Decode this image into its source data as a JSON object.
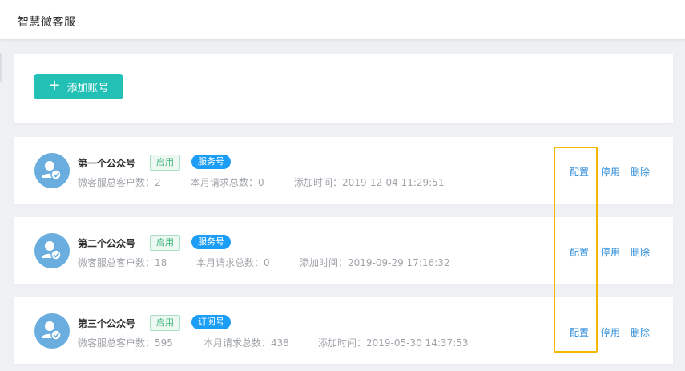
{
  "app": {
    "title": "智慧微客服"
  },
  "toolbar": {
    "add_label": "添加账号",
    "add_icon": "plus-icon"
  },
  "accounts": [
    {
      "name": "第一个公众号",
      "status": "启用",
      "type": "服务号",
      "customers": "微客服总客户数：2",
      "requests": "本月请求总数：0",
      "added": "添加时间：2019-12-04 11:29:51",
      "actions": {
        "config": "配置",
        "disable": "停用",
        "delete": "删除"
      }
    },
    {
      "name": "第二个公众号",
      "status": "启用",
      "type": "服务号",
      "customers": "微客服总客户数：18",
      "requests": "本月请求总数：0",
      "added": "添加时间：2019-09-29 17:16:32",
      "actions": {
        "config": "配置",
        "disable": "停用",
        "delete": "删除"
      }
    },
    {
      "name": "第三个公众号",
      "status": "启用",
      "type": "订阅号",
      "customers": "微客服总客户数：595",
      "requests": "本月请求总数：438",
      "added": "添加时间：2019-05-30 14:37:53",
      "actions": {
        "config": "配置",
        "disable": "停用",
        "delete": "删除"
      }
    }
  ],
  "colors": {
    "primary": "#22c0b5",
    "link": "#2a8ad8",
    "tag_blue": "#1d9ef6",
    "status_green": "#3bb37a",
    "highlight": "#f5b800",
    "avatar": "#6aaee0"
  }
}
